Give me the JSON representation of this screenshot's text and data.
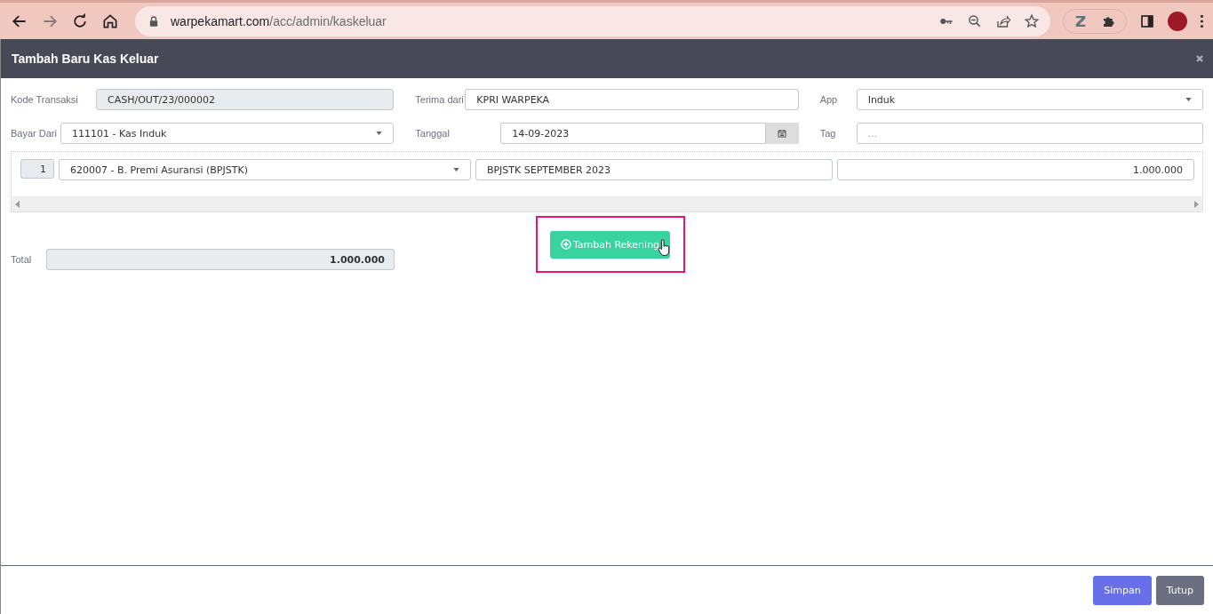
{
  "browser": {
    "url_host": "warpekamart.com",
    "url_path": "/acc/admin/kaskeluar"
  },
  "modal": {
    "title": "Tambah Baru Kas Keluar"
  },
  "form_rows": [
    [
      {
        "label": "Kode Transaksi",
        "kind": "readonly",
        "value": "CASH/OUT/23/000002"
      },
      {
        "label": "Terima dari",
        "kind": "text",
        "value": "KPRI WARPEKA"
      },
      {
        "label": "App",
        "kind": "select",
        "value": "Induk"
      }
    ],
    [
      {
        "label": "Bayar Dari",
        "kind": "select",
        "value": "111101 - Kas Induk"
      },
      {
        "label": "Tanggal",
        "kind": "date",
        "value": "14-09-2023"
      },
      {
        "label": "Tag",
        "kind": "text",
        "placeholder": "..."
      }
    ]
  ],
  "lines": [
    {
      "number": "1",
      "account": "620007 - B. Premi Asuransi (BPJSTK)",
      "description": "BPJSTK SEPTEMBER 2023",
      "amount": "1.000.000"
    }
  ],
  "add_button": {
    "label": "Tambah Rekening",
    "highlighted": true
  },
  "total": {
    "label": "Total",
    "value": "1.000.000"
  },
  "footer_buttons": [
    {
      "label": "Simpan",
      "kind": "primary"
    },
    {
      "label": "Tutup",
      "kind": "secondary"
    }
  ]
}
